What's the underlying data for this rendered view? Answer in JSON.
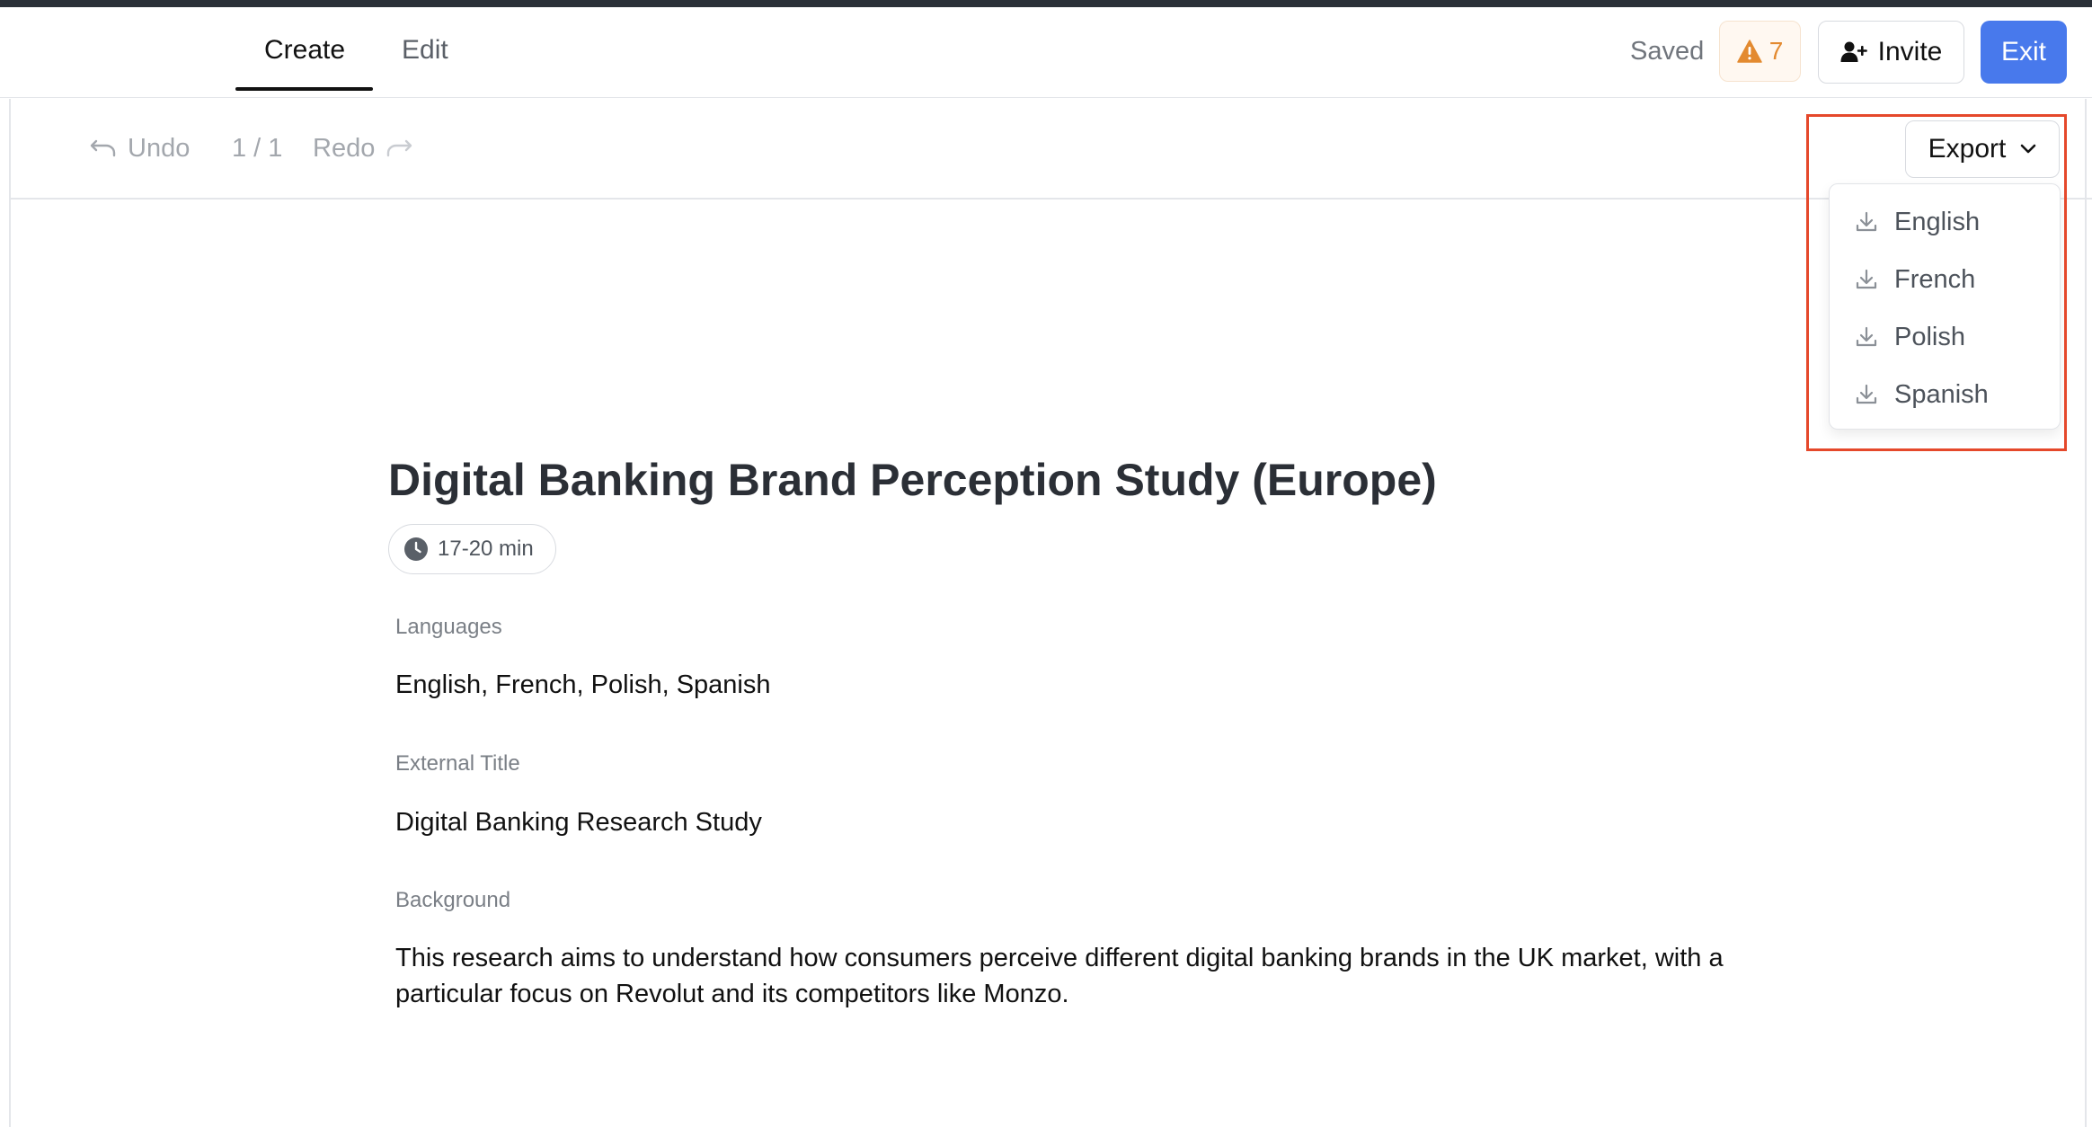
{
  "header": {
    "tabs": [
      {
        "label": "Create",
        "active": true
      },
      {
        "label": "Edit",
        "active": false
      }
    ],
    "save_status": "Saved",
    "warning_count": "7",
    "invite_label": "Invite",
    "exit_label": "Exit",
    "colors": {
      "primary": "#4879ec",
      "warning": "#e38a30"
    }
  },
  "toolbar": {
    "undo_label": "Undo",
    "page_indicator": "1 / 1",
    "redo_label": "Redo",
    "export_label": "Export",
    "export_menu": [
      "English",
      "French",
      "Polish",
      "Spanish"
    ]
  },
  "document": {
    "title": "Digital Banking Brand Perception Study (Europe)",
    "duration": "17-20 min",
    "fields": [
      {
        "label": "Languages",
        "value": "English, French, Polish, Spanish"
      },
      {
        "label": "External Title",
        "value": "Digital Banking Research Study"
      },
      {
        "label": "Background",
        "value": "This research aims to understand how consumers perceive different digital banking brands in the UK market, with a particular focus on Revolut and its competitors like Monzo."
      }
    ]
  }
}
